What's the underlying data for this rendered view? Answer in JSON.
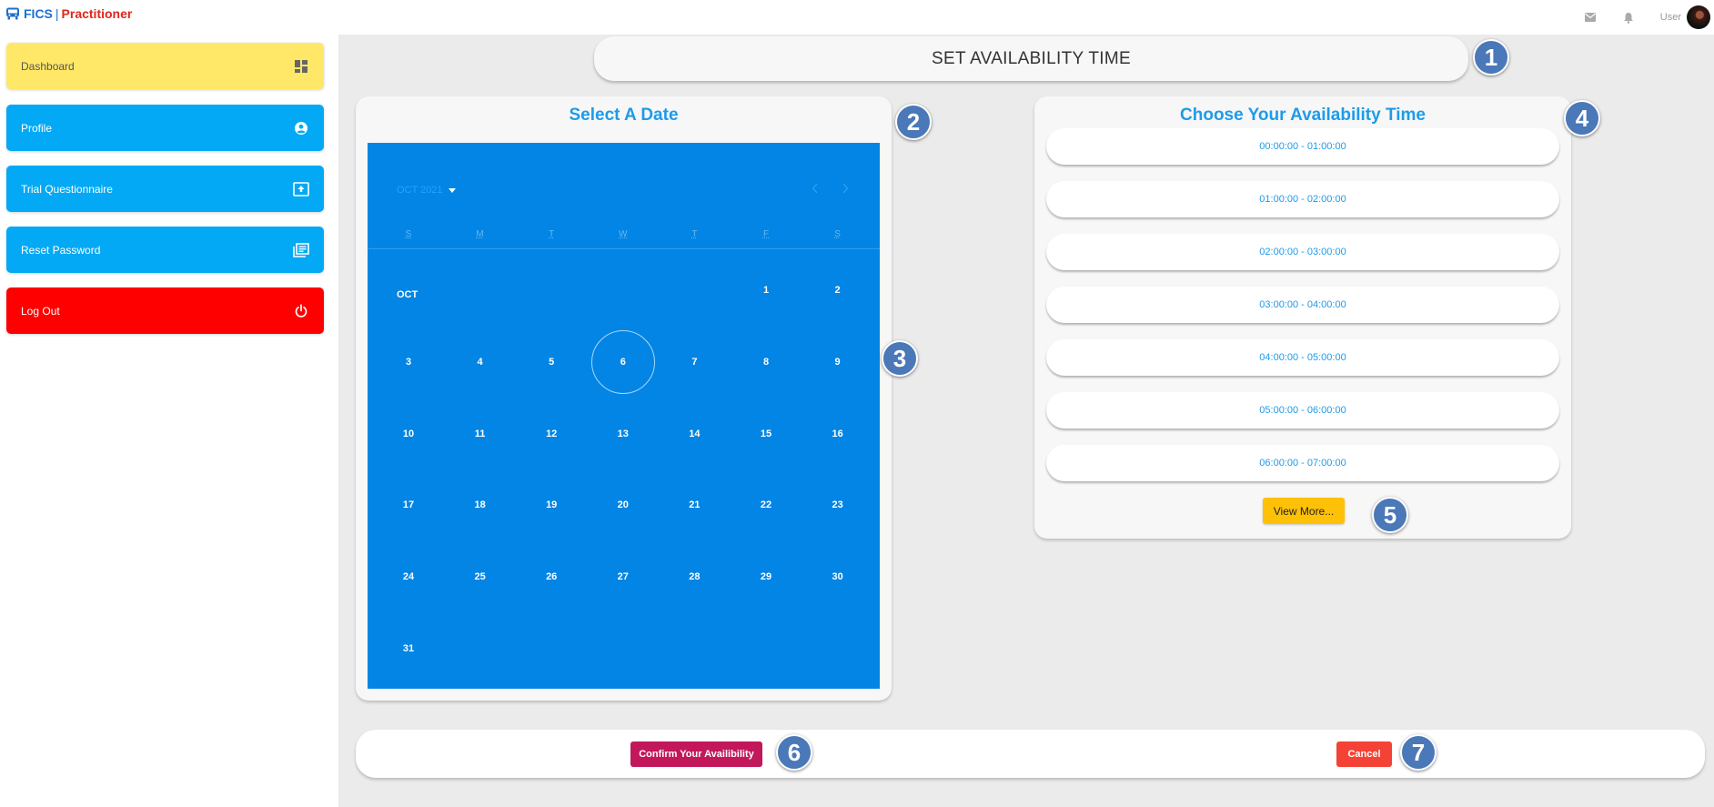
{
  "header": {
    "brand_fics": "FICS",
    "brand_separator": "|",
    "brand_role": "Practitioner",
    "icons": [
      "bus-icon",
      "mail-icon",
      "bell-icon"
    ],
    "user_label": "User"
  },
  "sidebar": {
    "items": [
      {
        "label": "Dashboard",
        "icon": "dashboard-icon"
      },
      {
        "label": "Profile",
        "icon": "account-circle-icon"
      },
      {
        "label": "Trial Questionnaire",
        "icon": "upload-box-icon"
      },
      {
        "label": "Reset Password",
        "icon": "library-books-icon"
      },
      {
        "label": "Log Out",
        "icon": "power-icon"
      }
    ]
  },
  "page": {
    "title": "SET AVAILABILITY TIME"
  },
  "calendar": {
    "title": "Select A Date",
    "month_year": "OCT 2021",
    "weekdays": [
      "S",
      "M",
      "T",
      "W",
      "T",
      "F",
      "S"
    ],
    "month_label": "OCT",
    "first_weekday_index": 5,
    "days_in_month": 31,
    "today": 6,
    "day_labels": [
      "1",
      "2",
      "3",
      "4",
      "5",
      "6",
      "7",
      "8",
      "9",
      "10",
      "11",
      "12",
      "13",
      "14",
      "15",
      "16",
      "17",
      "18",
      "19",
      "20",
      "21",
      "22",
      "23",
      "24",
      "25",
      "26",
      "27",
      "28",
      "29",
      "30",
      "31"
    ]
  },
  "availability": {
    "title": "Choose Your Availability Time",
    "slots": [
      "00:00:00 - 01:00:00",
      "01:00:00 - 02:00:00",
      "02:00:00 - 03:00:00",
      "03:00:00 - 04:00:00",
      "04:00:00 - 05:00:00",
      "05:00:00 - 06:00:00",
      "06:00:00 - 07:00:00"
    ],
    "view_more_label": "View More..."
  },
  "actions": {
    "confirm_label": "Confirm Your Availibility",
    "cancel_label": "Cancel"
  },
  "markers": [
    "1",
    "2",
    "3",
    "4",
    "5",
    "6",
    "7"
  ],
  "colors": {
    "primary_blue": "#03a9f4",
    "calendar_blue": "#0285e4",
    "dashboard_yellow": "#ffe867",
    "logout_red": "#ff0000",
    "confirm": "#c2185b",
    "cancel": "#f44336",
    "view_more": "#ffc107",
    "marker": "#4a78b8"
  }
}
